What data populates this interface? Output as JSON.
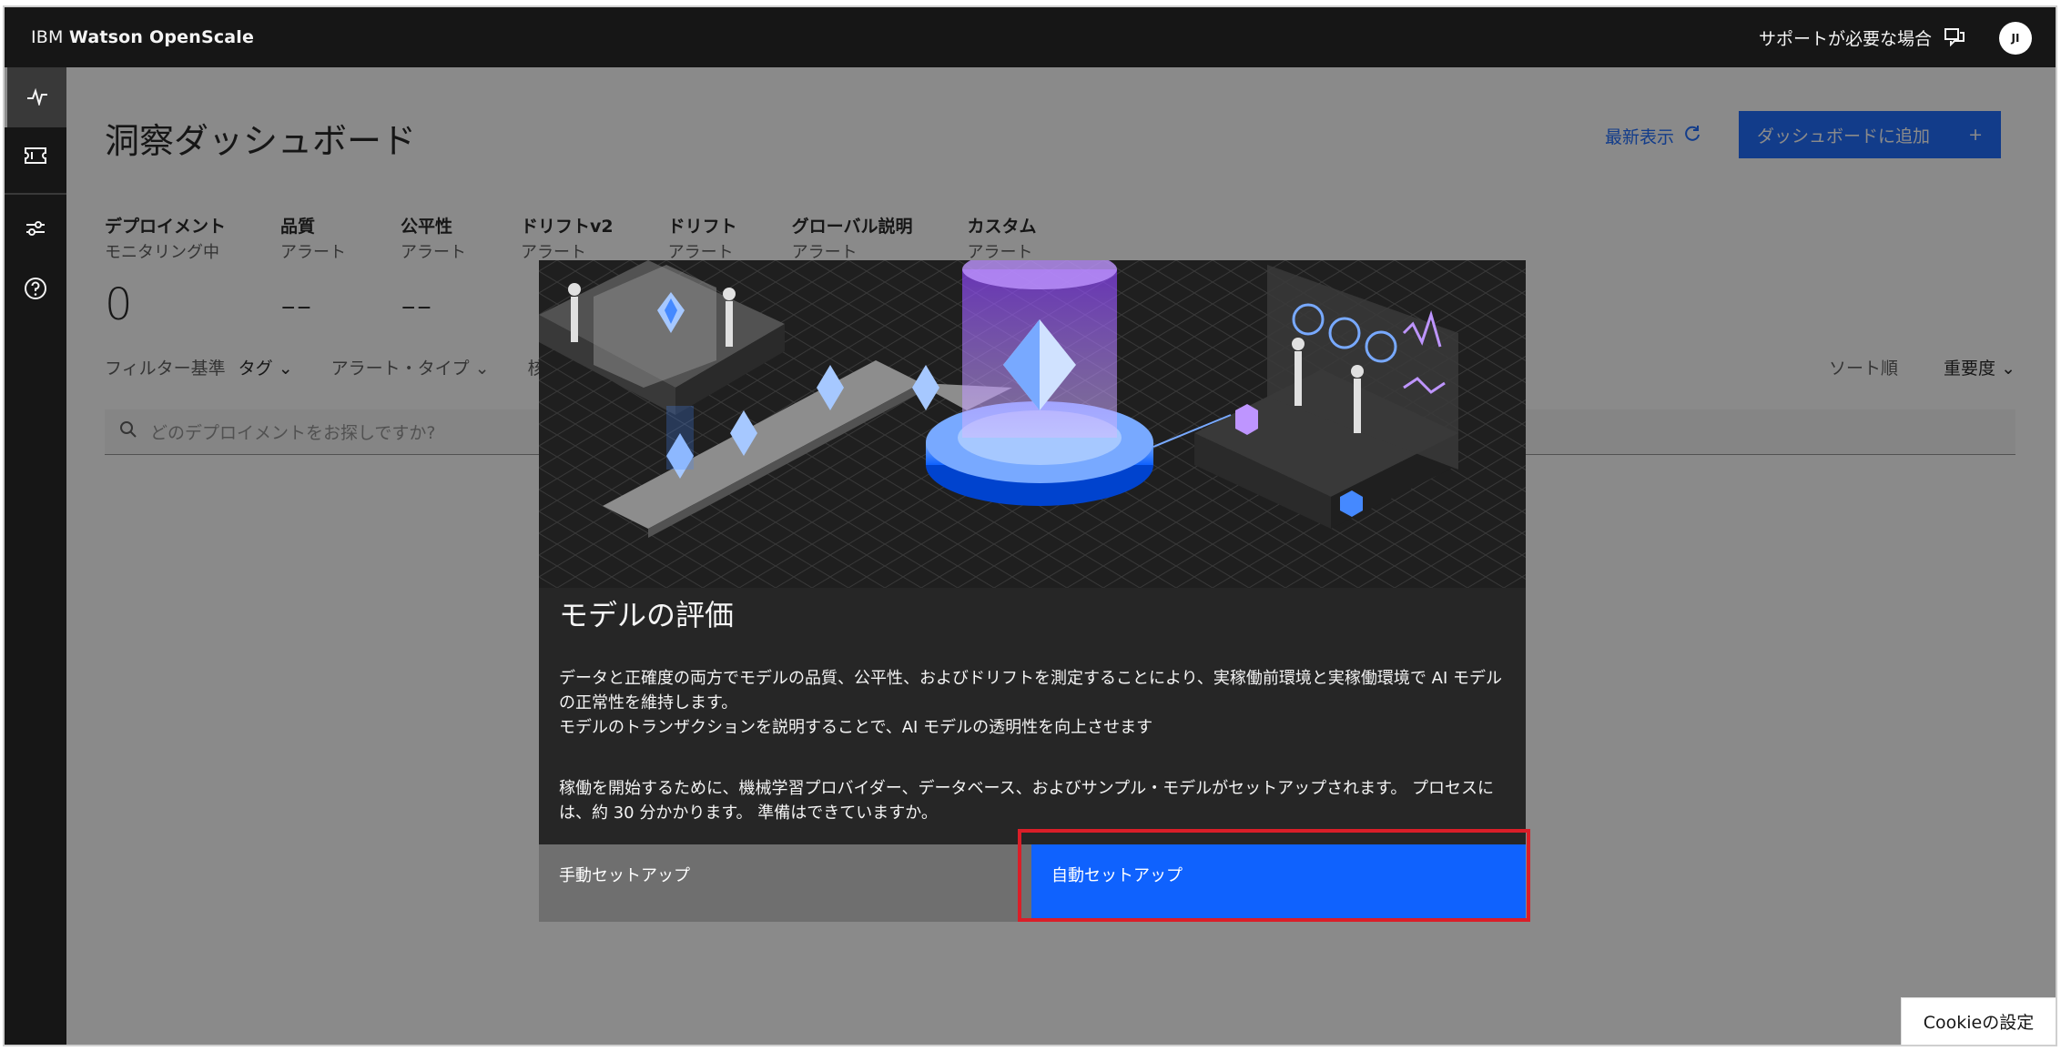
{
  "header": {
    "brand_prefix": "IBM",
    "brand_name": "Watson OpenScale",
    "support_text": "サポートが必要な場合",
    "avatar_initials": "JI"
  },
  "sidebar": {
    "items": [
      {
        "icon": "activity-icon",
        "active": true
      },
      {
        "icon": "ticket-icon",
        "active": false
      },
      {
        "icon": "sliders-icon",
        "active": false
      },
      {
        "icon": "help-icon",
        "active": false
      }
    ]
  },
  "page": {
    "title": "洞察ダッシュボード",
    "refresh_label": "最新表示",
    "add_label": "ダッシュボードに追加",
    "add_icon": "+"
  },
  "metrics": [
    {
      "title": "デプロイメント",
      "subtitle": "モニタリング中",
      "value": "0"
    },
    {
      "title": "品質",
      "subtitle": "アラート",
      "value": "--"
    },
    {
      "title": "公平性",
      "subtitle": "アラート",
      "value": "--"
    },
    {
      "title": "ドリフトv2",
      "subtitle": "アラート",
      "value": ""
    },
    {
      "title": "ドリフト",
      "subtitle": "アラート",
      "value": ""
    },
    {
      "title": "グローバル説明",
      "subtitle": "アラート",
      "value": ""
    },
    {
      "title": "カスタム",
      "subtitle": "アラート",
      "value": ""
    }
  ],
  "filters": {
    "label": "フィルター基準",
    "tag": "タグ",
    "alert_type": "アラート・タイプ",
    "truncated": "核"
  },
  "sort": {
    "label": "ソート順",
    "value": "重要度"
  },
  "search": {
    "placeholder": "どのデプロイメントをお探しですか?"
  },
  "modal": {
    "title": "モデルの評価",
    "paragraph1_line1": "データと正確度の両方でモデルの品質、公平性、およびドリフトを測定することにより、実稼働前環境と実稼働環境で AI モデルの正常性を維持します。",
    "paragraph1_line2": "モデルのトランザクションを説明することで、AI モデルの透明性を向上させます",
    "paragraph2": "稼働を開始するために、機械学習プロバイダー、データベース、およびサンプル・モデルがセットアップされます。 プロセスには、約 30 分かかります。 準備はできていますか。",
    "secondary_button": "手動セットアップ",
    "primary_button": "自動セットアップ"
  },
  "cookie": {
    "label": "Cookieの設定"
  },
  "colors": {
    "accent": "#0f62fe",
    "highlight": "#da1e28",
    "header": "#161616"
  }
}
